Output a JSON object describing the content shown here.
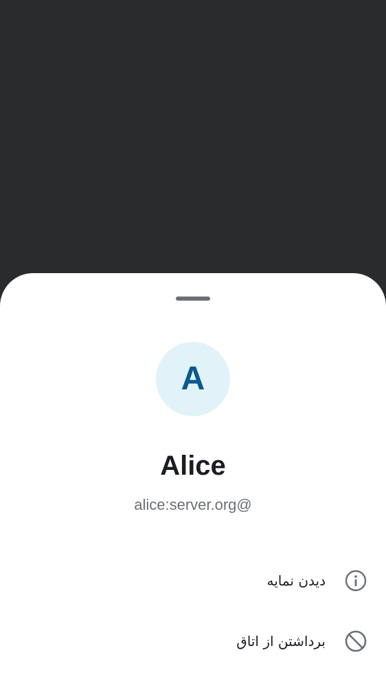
{
  "user": {
    "avatar_letter": "A",
    "display_name": "Alice",
    "user_id": "alice:server.org@"
  },
  "actions": [
    {
      "label": "دیدن نمایه",
      "icon": "info-icon"
    },
    {
      "label": "برداشتن از اتاق",
      "icon": "block-icon"
    }
  ],
  "colors": {
    "scrim": "#2a2b2d",
    "sheet": "#ffffff",
    "avatar_bg": "#e1f3f8",
    "avatar_text": "#0a5a8f",
    "primary_text": "#1b1d22",
    "secondary_text": "#6b6f76"
  }
}
